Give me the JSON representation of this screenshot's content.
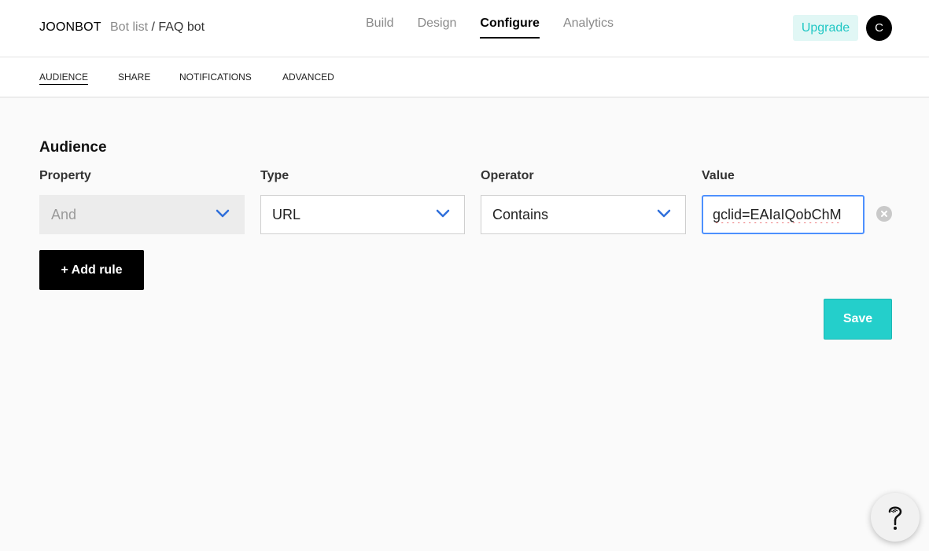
{
  "header": {
    "brand": "JOONBOT",
    "breadcrumb_root": "Bot list",
    "breadcrumb_sep": " / ",
    "breadcrumb_current": "FAQ bot",
    "nav": [
      {
        "label": "Build",
        "active": false
      },
      {
        "label": "Design",
        "active": false
      },
      {
        "label": "Configure",
        "active": true
      },
      {
        "label": "Analytics",
        "active": false
      }
    ],
    "upgrade_label": "Upgrade",
    "avatar_initial": "C"
  },
  "subnav": {
    "tabs": [
      {
        "label": "AUDIENCE",
        "active": true
      },
      {
        "label": "SHARE",
        "active": false
      },
      {
        "label": "NOTIFICATIONS",
        "active": false
      },
      {
        "label": "ADVANCED",
        "active": false
      }
    ]
  },
  "audience": {
    "title": "Audience",
    "columns": {
      "property": "Property",
      "type": "Type",
      "operator": "Operator",
      "value": "Value"
    },
    "rule": {
      "property": "And",
      "type": "URL",
      "operator": "Contains",
      "value": "gclid=EAIaIQobChM"
    },
    "add_rule_label": "+ Add rule",
    "save_label": "Save"
  },
  "colors": {
    "accent": "#24cfcb",
    "upgrade_bg": "#e1f7f5",
    "chevron": "#2f6fdb",
    "focus": "#4d90fe"
  },
  "icons": {
    "dropdown": "chevron-down-icon",
    "clear": "close-circle-icon",
    "help": "question-mark-icon"
  }
}
